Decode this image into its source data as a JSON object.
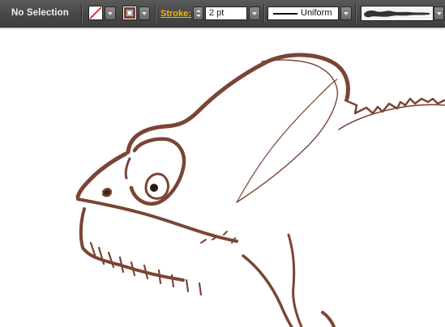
{
  "control_bar": {
    "selection_label": "No Selection",
    "stroke_label": "Stroke:",
    "stroke_weight": "2 pt",
    "variable_width_profile": "Uniform"
  },
  "icons": {
    "fill": "fill-none-swatch-icon",
    "stroke": "stroke-color-swatch-icon",
    "brush": "brush-stroke-icon"
  },
  "colors": {
    "toolbar_bg": "#4a4a4a",
    "stroke_link": "#ffb400",
    "art_stroke": "#7a4535",
    "canvas_bg": "#ffffff"
  }
}
